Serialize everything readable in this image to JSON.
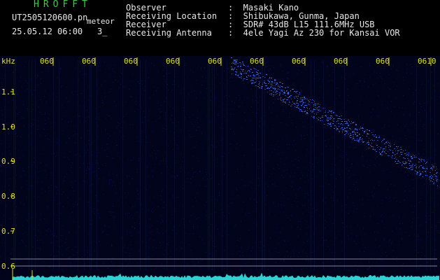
{
  "header": {
    "app_title": "HROFFT",
    "file_name": "UT2505120600.pn",
    "file_tag": "meteor",
    "date_time": "25.05.12 06:00",
    "counter": "3_",
    "info": [
      {
        "label": "Observer",
        "value": ":  Masaki Kano"
      },
      {
        "label": "Receiving Location",
        "value": ":  Shibukawa, Gunma, Japan"
      },
      {
        "label": "Receiver",
        "value": ":  SDR# 43dB L15 111.6MHz USB"
      },
      {
        "label": "Receiving Antenna",
        "value": ":  4ele Yagi Az 230 for Kansai VOR"
      }
    ]
  },
  "spectrogram": {
    "y_unit": "kHz",
    "y_ticks": [
      "1.1",
      "1.0",
      "0.9",
      "0.8",
      "0.7",
      "0.6"
    ],
    "x_ticks": [
      "060",
      "060",
      "060",
      "060",
      "060",
      "060",
      "060",
      "060",
      "060",
      "0610"
    ],
    "colors": {
      "background": "#02041c",
      "signal": "#3a4cff",
      "labels": "#e0e000",
      "baseline": "#2fd2d2",
      "rule": "#b0b0c8"
    }
  }
}
